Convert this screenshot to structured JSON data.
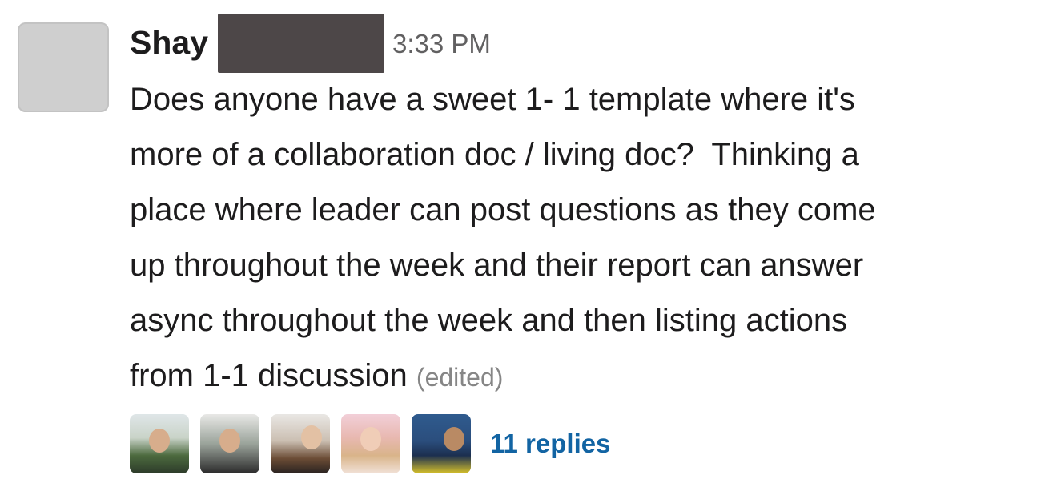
{
  "message": {
    "sender": "Shay",
    "timestamp": "3:33 PM",
    "body_lines": [
      "Does anyone have a sweet 1- 1 template where it's",
      "more of a collaboration doc / living doc?  Thinking a",
      "place where leader can post questions as they come",
      "up throughout the week and their report can answer",
      "async throughout the week and then listing actions",
      "from 1-1 discussion"
    ],
    "edited_label": "(edited)"
  },
  "thread": {
    "replies_label": "11 replies",
    "link_color": "#1264a3"
  },
  "colors": {
    "text": "#1d1c1d",
    "timestamp": "#616061",
    "edited": "#868686",
    "redaction": "#4d4748"
  }
}
